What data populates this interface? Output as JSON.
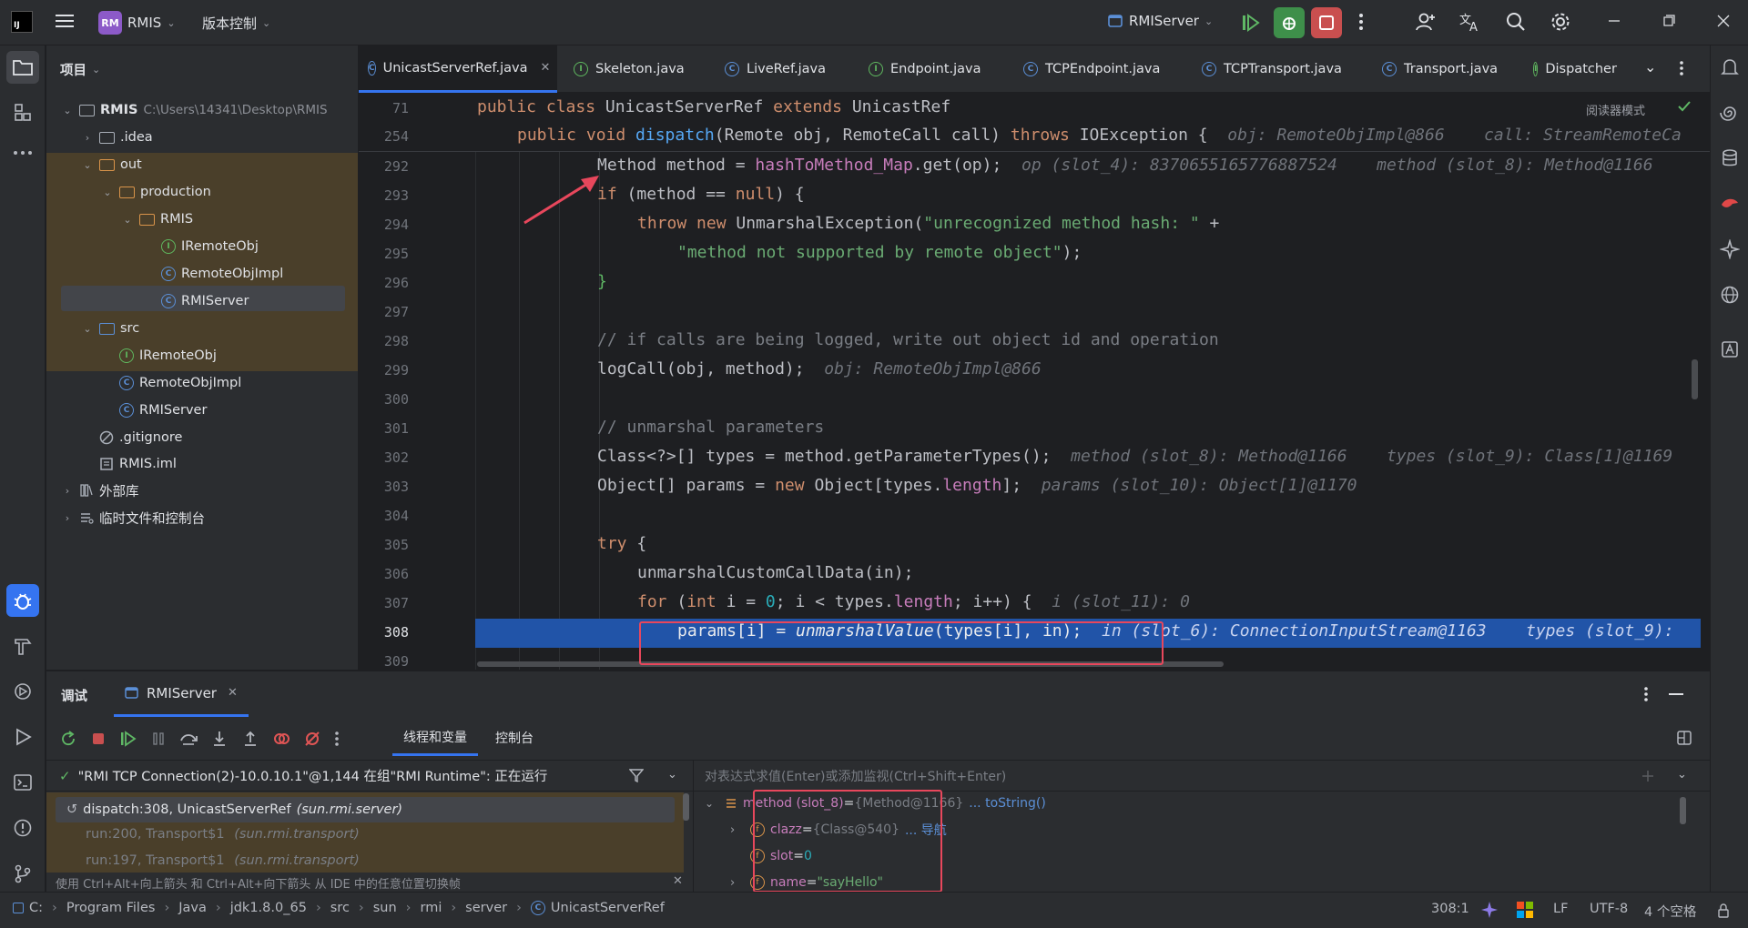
{
  "titlebar": {
    "project_badge": "RM",
    "project_name": "RMIS",
    "vcs_label": "版本控制",
    "run_config": "RMIServer"
  },
  "project_panel": {
    "title": "项目",
    "tree": [
      {
        "label": "RMIS",
        "path": "C:\\Users\\14341\\Desktop\\RMIS",
        "type": "folder-root",
        "expanded": true
      },
      {
        "label": ".idea",
        "type": "folder",
        "expanded": false
      },
      {
        "label": "out",
        "type": "folder-excluded",
        "expanded": true
      },
      {
        "label": "production",
        "type": "folder-excluded",
        "expanded": true
      },
      {
        "label": "RMIS",
        "type": "folder-excluded",
        "expanded": true
      },
      {
        "label": "IRemoteObj",
        "type": "interface"
      },
      {
        "label": "RemoteObjImpl",
        "type": "class"
      },
      {
        "label": "RMIServer",
        "type": "class-main",
        "selected": true
      },
      {
        "label": "src",
        "type": "folder-source",
        "expanded": true
      },
      {
        "label": "IRemoteObj",
        "type": "interface"
      },
      {
        "label": "RemoteObjImpl",
        "type": "class"
      },
      {
        "label": "RMIServer",
        "type": "class-main"
      },
      {
        "label": ".gitignore",
        "type": "ignore"
      },
      {
        "label": "RMIS.iml",
        "type": "iml"
      },
      {
        "label": "外部库",
        "type": "library"
      },
      {
        "label": "临时文件和控制台",
        "type": "scratch"
      }
    ]
  },
  "editor": {
    "tabs": [
      {
        "label": "UnicastServerRef.java",
        "active": true
      },
      {
        "label": "Skeleton.java"
      },
      {
        "label": "LiveRef.java"
      },
      {
        "label": "Endpoint.java"
      },
      {
        "label": "TCPEndpoint.java"
      },
      {
        "label": "TCPTransport.java"
      },
      {
        "label": "Transport.java"
      },
      {
        "label": "Dispatcher"
      }
    ],
    "reader_mode": "阅读器模式",
    "sticky": [
      {
        "num": "71",
        "code": "public class UnicastServerRef extends UnicastRef"
      },
      {
        "num": "254",
        "code": "public void dispatch(Remote obj, RemoteCall call) throws IOException {",
        "hint": "obj: RemoteObjImpl@866    call: StreamRemoteCa"
      }
    ],
    "lines": [
      {
        "num": "292",
        "code": "Method method = hashToMethod_Map.get(op);",
        "hint": "op (slot_4): 8370655165776887524    method (slot_8): Method@1166"
      },
      {
        "num": "293",
        "code": "if (method == null) {"
      },
      {
        "num": "294",
        "code": "throw new UnmarshalException(\"unrecognized method hash: \" +"
      },
      {
        "num": "295",
        "code": "\"method not supported by remote object\");"
      },
      {
        "num": "296",
        "code": "}"
      },
      {
        "num": "297",
        "code": ""
      },
      {
        "num": "298",
        "code": "// if calls are being logged, write out object id and operation"
      },
      {
        "num": "299",
        "code": "logCall(obj, method);",
        "hint": "obj: RemoteObjImpl@866"
      },
      {
        "num": "300",
        "code": ""
      },
      {
        "num": "301",
        "code": "// unmarshal parameters"
      },
      {
        "num": "302",
        "code": "Class<?>[] types = method.getParameterTypes();",
        "hint": "method (slot_8): Method@1166    types (slot_9): Class[1]@1169"
      },
      {
        "num": "303",
        "code": "Object[] params = new Object[types.length];",
        "hint": "params (slot_10): Object[1]@1170"
      },
      {
        "num": "304",
        "code": ""
      },
      {
        "num": "305",
        "code": "try {"
      },
      {
        "num": "306",
        "code": "unmarshalCustomCallData(in);"
      },
      {
        "num": "307",
        "code": "for (int i = 0; i < types.length; i++) {",
        "hint": "i (slot_11): 0"
      },
      {
        "num": "308",
        "code": "params[i] = unmarshalValue(types[i], in);",
        "hint": "in (slot_6): ConnectionInputStream@1163    types (slot_9):"
      },
      {
        "num": "309",
        "code": ""
      }
    ]
  },
  "debug": {
    "tab_title": "调试",
    "session": "RMIServer",
    "subtabs": [
      "线程和变量",
      "控制台"
    ],
    "thread": "\"RMI TCP Connection(2)-10.0.10.1\"@1,144 在组\"RMI Runtime\": 正在运行",
    "frames": [
      {
        "method": "dispatch:308, UnicastServerRef",
        "pkg": "(sun.rmi.server)"
      },
      {
        "method": "run:200, Transport$1",
        "pkg": "(sun.rmi.transport)"
      },
      {
        "method": "run:197, Transport$1",
        "pkg": "(sun.rmi.transport)"
      }
    ],
    "frames_hint": "使用 Ctrl+Alt+向上箭头 和 Ctrl+Alt+向下箭头 从 IDE 中的任意位置切换帧",
    "eval_placeholder": "对表达式求值(Enter)或添加监视(Ctrl+Shift+Enter)",
    "variables": [
      {
        "name": "method (slot_8)",
        "eq": " = ",
        "value": "{Method@1166}",
        "link": "... toString()",
        "expanded": true
      },
      {
        "name": "clazz",
        "eq": " = ",
        "value": "{Class@540}",
        "link": "... 导航"
      },
      {
        "name": "slot",
        "eq": " = ",
        "value": "0"
      },
      {
        "name": "name",
        "eq": " = ",
        "value": "\"sayHello\""
      }
    ]
  },
  "statusbar": {
    "breadcrumb": [
      "C:",
      "Program Files",
      "Java",
      "jdk1.8.0_65",
      "src",
      "sun",
      "rmi",
      "server",
      "UnicastServerRef"
    ],
    "position": "308:1",
    "line_sep": "LF",
    "encoding": "UTF-8",
    "indent": "4 个空格"
  }
}
